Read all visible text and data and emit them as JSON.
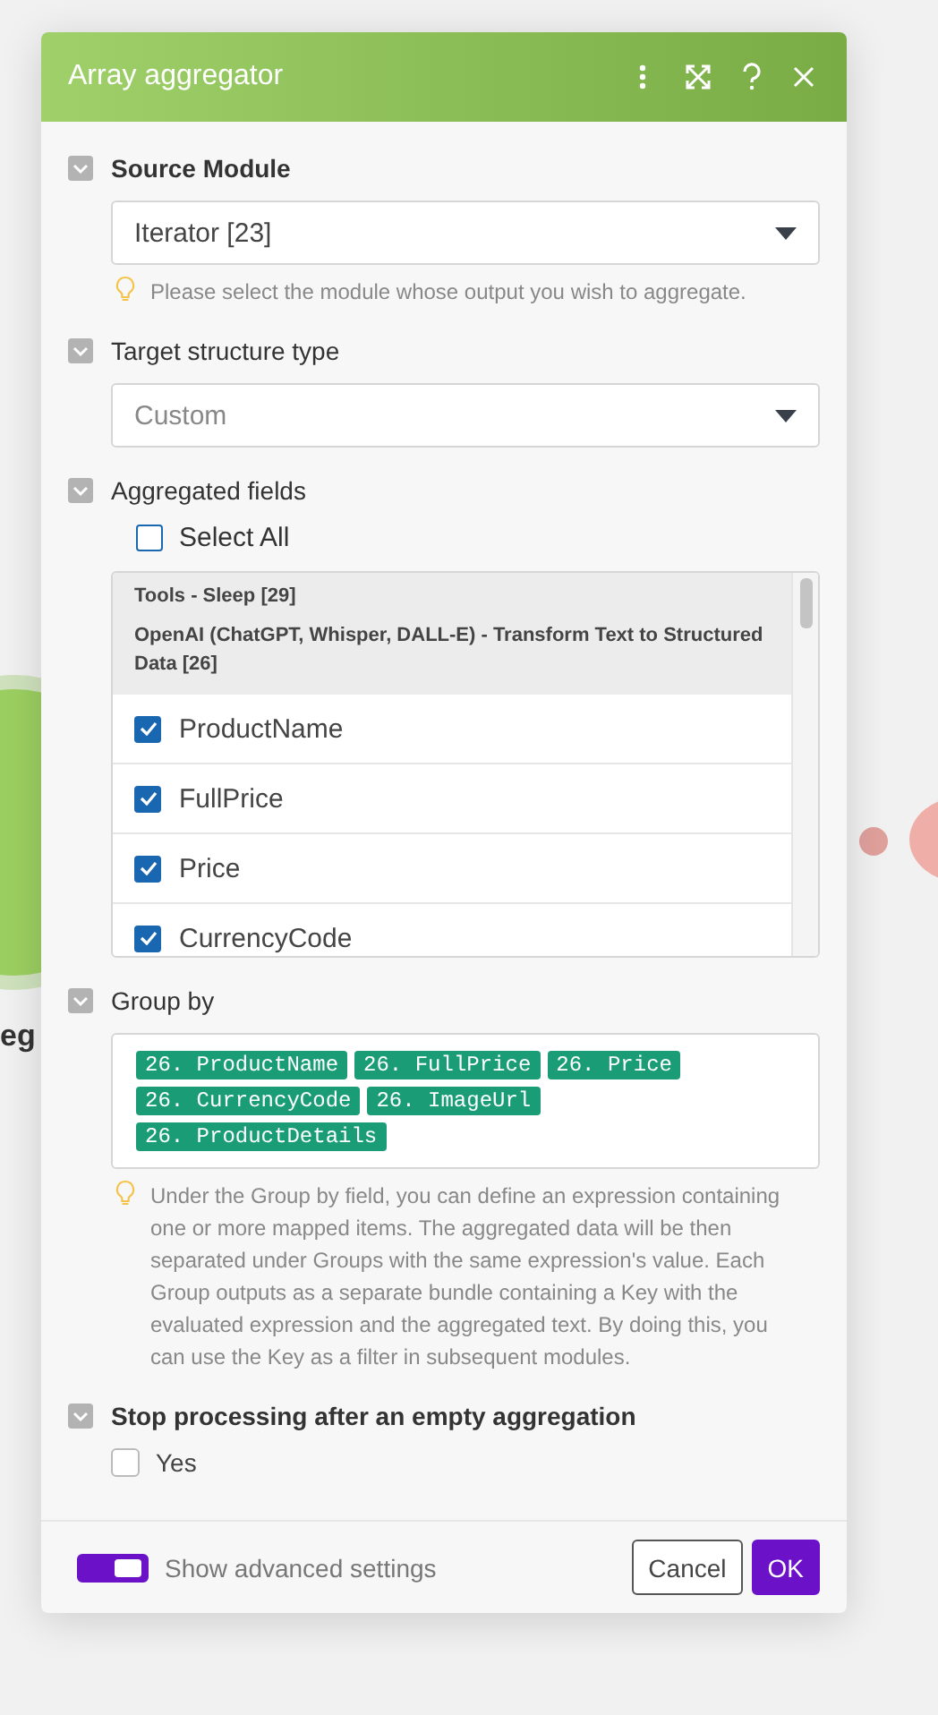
{
  "canvas": {
    "node_label": "eg"
  },
  "dialog": {
    "title": "Array aggregator",
    "sections": [
      {
        "kind": "select",
        "label": "Source Module",
        "required": true,
        "expanded": true,
        "value": "Iterator [23]",
        "hint": "Please select the module whose output you wish to aggregate."
      },
      {
        "kind": "select",
        "label": "Target structure type",
        "required": false,
        "expanded": true,
        "placeholder": "Custom"
      },
      {
        "kind": "fields",
        "label": "Aggregated fields",
        "required": false,
        "expanded": true,
        "select_all": {
          "label": "Select All",
          "checked": false
        },
        "groups": [
          "Tools - Sleep [29]",
          "OpenAI (ChatGPT, Whisper, DALL-E) - Transform Text to Structured Data [26]"
        ],
        "items": [
          {
            "label": "ProductName",
            "checked": true
          },
          {
            "label": "FullPrice",
            "checked": true
          },
          {
            "label": "Price",
            "checked": true
          },
          {
            "label": "CurrencyCode",
            "checked": true
          }
        ]
      },
      {
        "kind": "tags",
        "label": "Group by",
        "required": false,
        "expanded": true,
        "tags": [
          "26. ProductName",
          "26. FullPrice",
          "26. Price",
          "26. CurrencyCode",
          "26. ImageUrl",
          "26. ProductDetails"
        ],
        "hint": "Under the Group by field, you can define an expression containing one or more mapped items. The aggregated data will be then separated under Groups with the same expression's value. Each Group outputs as a separate bundle containing a Key with the evaluated expression and the aggregated text. By doing this, you can use the Key as a filter in subsequent modules."
      },
      {
        "kind": "checkbox",
        "label": "Stop processing after an empty aggregation",
        "required": true,
        "expanded": true,
        "option": {
          "label": "Yes",
          "checked": false
        }
      }
    ],
    "footer": {
      "advanced": {
        "label": "Show advanced settings",
        "on": true
      },
      "buttons": [
        "Cancel",
        "OK"
      ]
    }
  }
}
